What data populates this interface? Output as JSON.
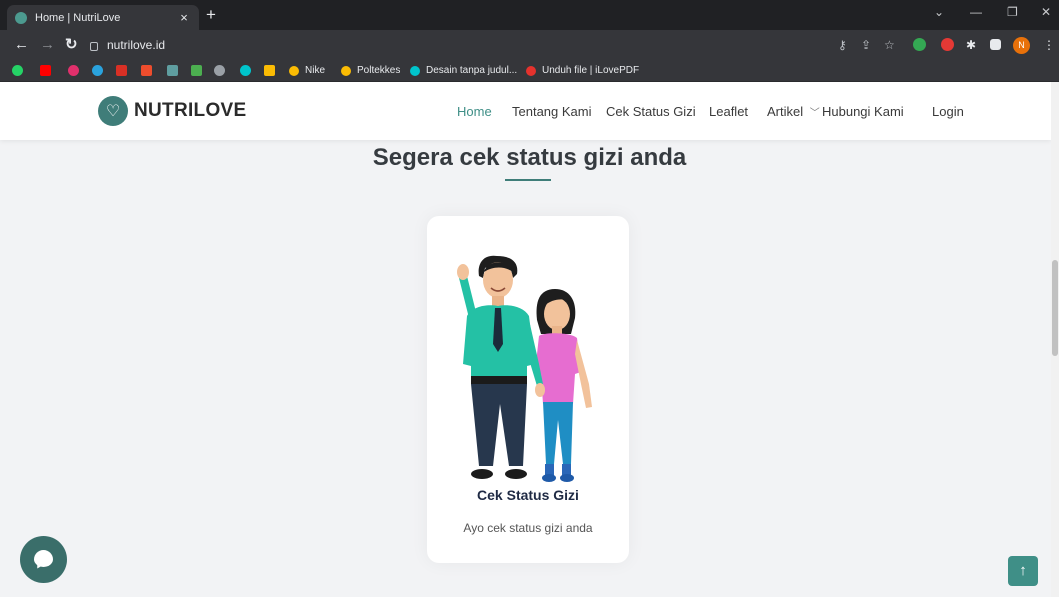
{
  "browser": {
    "tab_title": "Home | NutriLove",
    "tab_close": "×",
    "new_tab": "+",
    "url": "nutrilove.id",
    "profile_initial": "N",
    "bookmarks": [
      {
        "label": "Nike",
        "color": "#fbbc04"
      },
      {
        "label": "Poltekkes",
        "color": "#fbbc04"
      },
      {
        "label": "Desain tanpa judul...",
        "color": "#00c4cc"
      },
      {
        "label": "Unduh file | iLovePDF",
        "color": "#e5322d"
      }
    ]
  },
  "site": {
    "logo_text": "NUTRILOVE",
    "nav": [
      "Home",
      "Tentang Kami",
      "Cek Status Gizi",
      "Leaflet",
      "Artikel",
      "Hubungi Kami",
      "Login"
    ],
    "active_nav": "Home",
    "accent_color": "#3f8f87",
    "section_title": "Segera cek status gizi anda",
    "card": {
      "title": "Cek Status Gizi",
      "description": "Ayo cek status gizi anda"
    },
    "back_to_top": "↑"
  }
}
